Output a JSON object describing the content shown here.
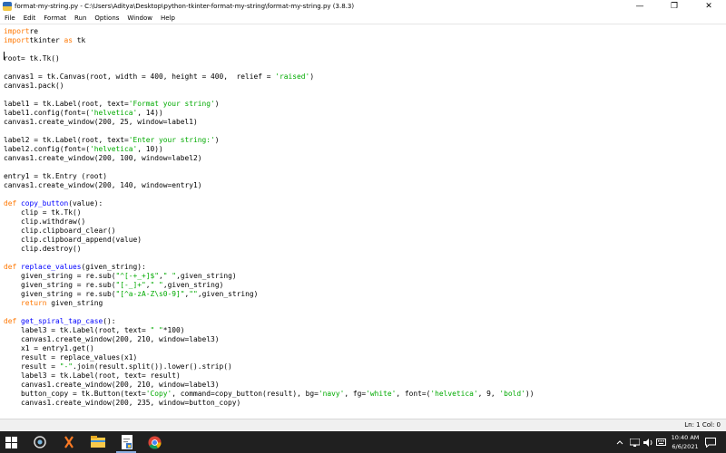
{
  "window": {
    "title": "format-my-string.py - C:\\Users\\Aditya\\Desktop\\python-tkinter-format-my-string\\format-my-string.py (3.8.3)",
    "minimize_icon": "minimize-icon",
    "maximize_icon": "restore-icon",
    "close_icon": "close-icon"
  },
  "menu": {
    "items": [
      "File",
      "Edit",
      "Format",
      "Run",
      "Options",
      "Window",
      "Help"
    ]
  },
  "editor": {
    "lines": [
      [
        [
          "kw",
          "import"
        ],
        [
          "",
          "re"
        ]
      ],
      [
        [
          "kw",
          "import"
        ],
        [
          "",
          "tkinter "
        ],
        [
          "kw",
          "as"
        ],
        [
          "",
          " tk"
        ]
      ],
      [],
      [
        [
          "",
          "root= tk.Tk()"
        ]
      ],
      [],
      [
        [
          "",
          "canvas1 = tk.Canvas(root, width = 400, height = 400,  relief = "
        ],
        [
          "st",
          "'raised'"
        ],
        [
          "",
          ")"
        ]
      ],
      [
        [
          "",
          "canvas1.pack()"
        ]
      ],
      [],
      [
        [
          "",
          "label1 = tk.Label(root, text="
        ],
        [
          "st",
          "'Format your string'"
        ],
        [
          "",
          ")"
        ]
      ],
      [
        [
          "",
          "label1.config(font=("
        ],
        [
          "st",
          "'helvetica'"
        ],
        [
          "",
          ", 14))"
        ]
      ],
      [
        [
          "",
          "canvas1.create_window(200, 25, window=label1)"
        ]
      ],
      [],
      [
        [
          "",
          "label2 = tk.Label(root, text="
        ],
        [
          "st",
          "'Enter your string:'"
        ],
        [
          "",
          ")"
        ]
      ],
      [
        [
          "",
          "label2.config(font=("
        ],
        [
          "st",
          "'helvetica'"
        ],
        [
          "",
          ", 10))"
        ]
      ],
      [
        [
          "",
          "canvas1.create_window(200, 100, window=label2)"
        ]
      ],
      [],
      [
        [
          "",
          "entry1 = tk.Entry (root)"
        ]
      ],
      [
        [
          "",
          "canvas1.create_window(200, 140, window=entry1)"
        ]
      ],
      [],
      [
        [
          "kw",
          "def"
        ],
        [
          "",
          " "
        ],
        [
          "fn",
          "copy_button"
        ],
        [
          "",
          "(value):"
        ]
      ],
      [
        [
          "",
          "    clip = tk.Tk()"
        ]
      ],
      [
        [
          "",
          "    clip.withdraw()"
        ]
      ],
      [
        [
          "",
          "    clip.clipboard_clear()"
        ]
      ],
      [
        [
          "",
          "    clip.clipboard_append(value)"
        ]
      ],
      [
        [
          "",
          "    clip.destroy()"
        ]
      ],
      [],
      [
        [
          "kw",
          "def"
        ],
        [
          "",
          " "
        ],
        [
          "fn",
          "replace_values"
        ],
        [
          "",
          "(given_string):"
        ]
      ],
      [
        [
          "",
          "    given_string = re.sub("
        ],
        [
          "st",
          "\"^[-+_+]$\""
        ],
        [
          "",
          ","
        ],
        [
          "st",
          "\" \""
        ],
        [
          "",
          ",given_string)"
        ]
      ],
      [
        [
          "",
          "    given_string = re.sub("
        ],
        [
          "st",
          "\"[-_]+\""
        ],
        [
          "",
          ","
        ],
        [
          "st",
          "\" \""
        ],
        [
          "",
          ",given_string)"
        ]
      ],
      [
        [
          "",
          "    given_string = re.sub("
        ],
        [
          "st",
          "\"[^a-zA-Z\\s0-9]\""
        ],
        [
          "",
          ","
        ],
        [
          "st",
          "\"\""
        ],
        [
          "",
          ",given_string)"
        ]
      ],
      [
        [
          "kw",
          "    return"
        ],
        [
          "",
          " given_string"
        ]
      ],
      [],
      [
        [
          "kw",
          "def"
        ],
        [
          "",
          " "
        ],
        [
          "fn",
          "get_spiral_tap_case"
        ],
        [
          "",
          "():"
        ]
      ],
      [
        [
          "",
          "    label3 = tk.Label(root, text= "
        ],
        [
          "st",
          "\" \""
        ],
        [
          "",
          "*100)"
        ]
      ],
      [
        [
          "",
          "    canvas1.create_window(200, 210, window=label3)"
        ]
      ],
      [
        [
          "",
          "    x1 = entry1.get()"
        ]
      ],
      [
        [
          "",
          "    result = replace_values(x1)"
        ]
      ],
      [
        [
          "",
          "    result = "
        ],
        [
          "st",
          "\"-\""
        ],
        [
          "",
          ".join(result.split()).lower().strip()"
        ]
      ],
      [
        [
          "",
          "    label3 = tk.Label(root, text= result)"
        ]
      ],
      [
        [
          "",
          "    canvas1.create_window(200, 210, window=label3)"
        ]
      ],
      [
        [
          "",
          "    button_copy = tk.Button(text="
        ],
        [
          "st",
          "'Copy'"
        ],
        [
          "",
          ", command=copy_button(result), bg="
        ],
        [
          "st",
          "'navy'"
        ],
        [
          "",
          ", fg="
        ],
        [
          "st",
          "'white'"
        ],
        [
          "",
          ", font=("
        ],
        [
          "st",
          "'helvetica'"
        ],
        [
          "",
          ", 9, "
        ],
        [
          "st",
          "'bold'"
        ],
        [
          "",
          "))"
        ]
      ],
      [
        [
          "",
          "    canvas1.create_window(200, 235, window=button_copy)"
        ]
      ]
    ]
  },
  "status": {
    "position": "Ln: 1   Col: 0"
  },
  "taskbar": {
    "time": "10:40 AM",
    "date": "6/6/2021",
    "icons": [
      "windows-start-icon",
      "search-icon",
      "task-view-icon",
      "xampp-icon",
      "file-explorer-icon",
      "idle-editor-icon",
      "chrome-icon"
    ],
    "tray_icons": [
      "chevron-up-icon",
      "network-icon",
      "volume-icon",
      "keyboard-icon",
      "notification-icon"
    ]
  }
}
